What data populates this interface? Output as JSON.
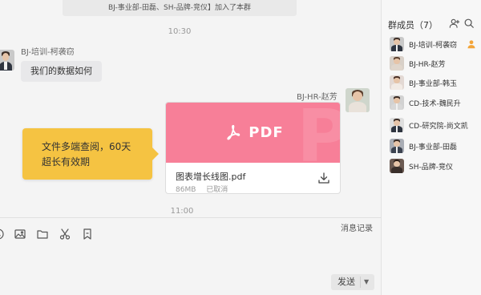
{
  "chat": {
    "system_notice": "BJ-事业部-田磊、SH-品牌-竞仪】加入了本群",
    "time_1": "10:30",
    "time_2": "11:00",
    "messages": [
      {
        "sender": "BJ-培训-柯袭窃",
        "text": "我们的数据如何"
      }
    ],
    "file_message": {
      "sender": "BJ-HR-赵芳",
      "preview_label": "PDF",
      "file_name": "图表增长线图.pdf",
      "file_size": "86MB",
      "status": "已取消"
    },
    "callout": {
      "line1": "文件多端查阅，60天",
      "line2": "超长有效期",
      "color": "#f5c342"
    }
  },
  "toolbar": {
    "icons": [
      "emoji-icon",
      "image-icon",
      "folder-icon",
      "scissors-icon",
      "bookmark-icon"
    ],
    "history_label": "消息记录"
  },
  "composer": {
    "send_label": "发送"
  },
  "members": {
    "title": "群成员（7）",
    "list": [
      {
        "name": "BJ-培训-柯袭窃",
        "owner": true
      },
      {
        "name": "BJ-HR-赵芳"
      },
      {
        "name": "BJ-事业部-韩玉"
      },
      {
        "name": "CD-技术-魏民升"
      },
      {
        "name": "CD-研究院-尚文凯"
      },
      {
        "name": "BJ-事业部-田磊"
      },
      {
        "name": "SH-品牌-竞仪"
      }
    ]
  },
  "colors": {
    "pdf_preview": "#f77f98",
    "owner_badge": "#f3a53a",
    "background": "#f4f4f4"
  }
}
